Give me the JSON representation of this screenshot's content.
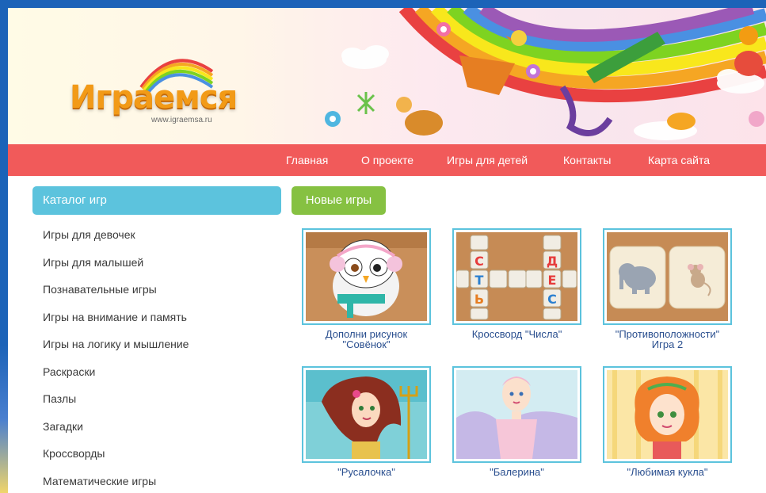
{
  "logo": {
    "title": "Играемся",
    "url": "www.igraemsa.ru"
  },
  "nav": {
    "items": [
      {
        "label": "Главная"
      },
      {
        "label": "О проекте"
      },
      {
        "label": "Игры для детей"
      },
      {
        "label": "Контакты"
      },
      {
        "label": "Карта сайта"
      }
    ]
  },
  "sidebar": {
    "header": "Каталог игр",
    "items": [
      {
        "label": "Игры для девочек"
      },
      {
        "label": "Игры для малышей"
      },
      {
        "label": "Познавательные игры"
      },
      {
        "label": "Игры на внимание и память"
      },
      {
        "label": "Игры на логику и мышление"
      },
      {
        "label": "Раскраски"
      },
      {
        "label": "Пазлы"
      },
      {
        "label": "Загадки"
      },
      {
        "label": "Кроссворды"
      },
      {
        "label": "Математические игры"
      }
    ]
  },
  "main": {
    "section_label": "Новые игры",
    "cards": [
      {
        "title_line1": "Дополни рисунок",
        "title_line2": "\"Совёнок\"",
        "icon": "owl-picture"
      },
      {
        "title_line1": "Кроссворд \"Числа\"",
        "title_line2": "",
        "icon": "crossword-picture",
        "letters": [
          "С",
          "Т",
          "Ь",
          "Д",
          "Е",
          "С"
        ]
      },
      {
        "title_line1": "\"Противоположности\"",
        "title_line2": "Игра 2",
        "icon": "elephant-mouse-picture"
      },
      {
        "title_line1": "\"Русалочка\"",
        "title_line2": "",
        "icon": "mermaid-picture"
      },
      {
        "title_line1": "\"Балерина\"",
        "title_line2": "",
        "icon": "ballerina-picture"
      },
      {
        "title_line1": "\"Любимая кукла\"",
        "title_line2": "",
        "icon": "doll-picture"
      }
    ]
  },
  "colors": {
    "nav_bg": "#f15a5a",
    "sidebar_header_bg": "#5cc3dd",
    "section_badge_bg": "#86c142",
    "card_border": "#5cc3dd",
    "card_title": "#2a4f8f",
    "logo_orange": "#f29a17"
  }
}
